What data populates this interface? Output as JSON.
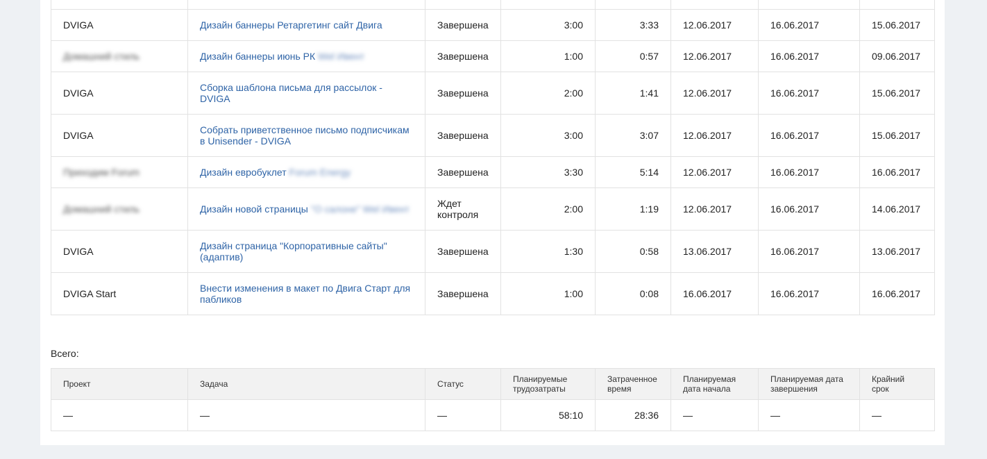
{
  "tasks": [
    {
      "project": "",
      "task": "",
      "status": "",
      "planned": "",
      "spent": "",
      "start": "",
      "end": "",
      "deadline": ""
    },
    {
      "project": "DVIGA",
      "task": "Дизайн баннеры Ретаргетинг сайт Двига",
      "status": "Завершена",
      "planned": "3:00",
      "spent": "3:33",
      "start": "12.06.2017",
      "end": "16.06.2017",
      "deadline": "15.06.2017"
    },
    {
      "project": "Домашний стиль",
      "project_blurred": true,
      "task": "Дизайн баннеры июнь РК",
      "task_suffix": "Wel Ивент",
      "status": "Завершена",
      "planned": "1:00",
      "spent": "0:57",
      "start": "12.06.2017",
      "end": "16.06.2017",
      "deadline": "09.06.2017"
    },
    {
      "project": "DVIGA",
      "task": "Сборка шаблона письма для рассылок - DVIGA",
      "status": "Завершена",
      "planned": "2:00",
      "spent": "1:41",
      "start": "12.06.2017",
      "end": "16.06.2017",
      "deadline": "15.06.2017"
    },
    {
      "project": "DVIGA",
      "task": "Собрать приветственное письмо подписчикам в Unisender - DVIGA",
      "status": "Завершена",
      "planned": "3:00",
      "spent": "3:07",
      "start": "12.06.2017",
      "end": "16.06.2017",
      "deadline": "15.06.2017"
    },
    {
      "project": "Приходим Forum",
      "project_blurred": true,
      "task": "Дизайн евробуклет",
      "task_suffix": "Forum Energy",
      "status": "Завершена",
      "planned": "3:30",
      "spent": "5:14",
      "start": "12.06.2017",
      "end": "16.06.2017",
      "deadline": "16.06.2017"
    },
    {
      "project": "Домашний стиль",
      "project_blurred": true,
      "task": "Дизайн новой страницы",
      "task_suffix": "\"О салоне\" Wel Ивент",
      "status": "Ждет контроля",
      "planned": "2:00",
      "spent": "1:19",
      "start": "12.06.2017",
      "end": "16.06.2017",
      "deadline": "14.06.2017"
    },
    {
      "project": "DVIGA",
      "task": "Дизайн страница \"Корпоративные сайты\" (адаптив)",
      "status": "Завершена",
      "planned": "1:30",
      "spent": "0:58",
      "start": "13.06.2017",
      "end": "16.06.2017",
      "deadline": "13.06.2017"
    },
    {
      "project": "DVIGA Start",
      "task": "Внести изменения в макет по Двига Старт для пабликов",
      "status": "Завершена",
      "planned": "1:00",
      "spent": "0:08",
      "start": "16.06.2017",
      "end": "16.06.2017",
      "deadline": "16.06.2017"
    }
  ],
  "totals": {
    "label": "Всего:",
    "headers": {
      "project": "Проект",
      "task": "Задача",
      "status": "Статус",
      "planned": "Планируемые трудозатраты",
      "spent": "Затраченное время",
      "start": "Планируемая дата начала",
      "end": "Планируемая дата завершения",
      "deadline": "Крайний срок"
    },
    "row": {
      "project": "—",
      "task": "—",
      "status": "—",
      "planned": "58:10",
      "spent": "28:36",
      "start": "—",
      "end": "—",
      "deadline": "—"
    }
  },
  "colors": {
    "link": "#2f64a7",
    "background": "#eef1f4",
    "header": "#f2f2f2",
    "border": "#e2e2e2"
  }
}
